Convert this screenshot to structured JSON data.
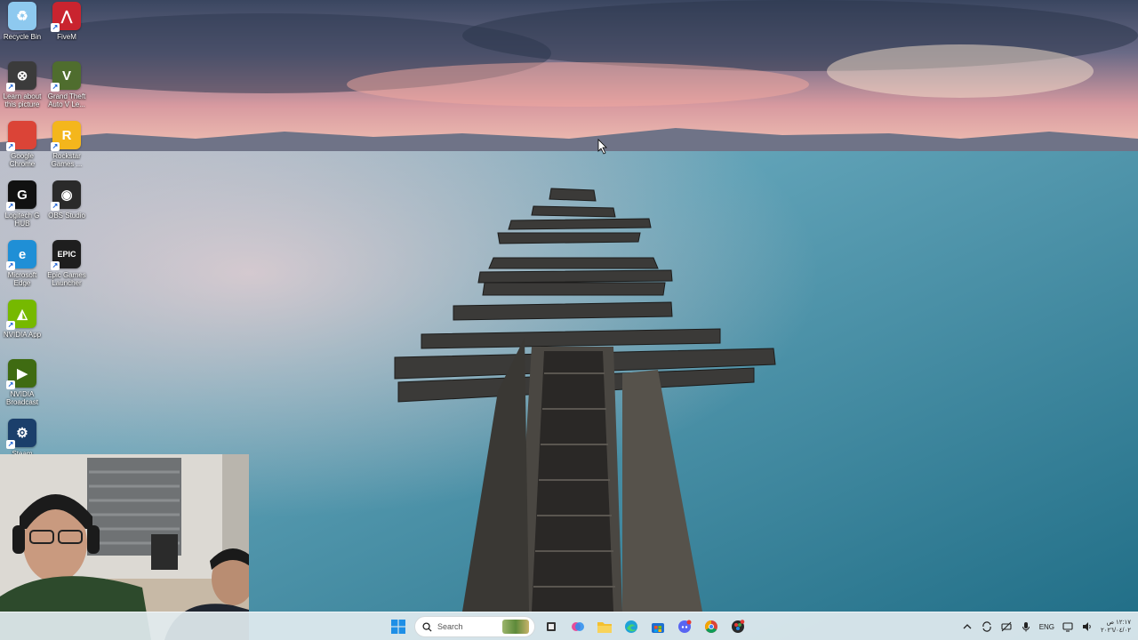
{
  "desktop": {
    "icons": [
      {
        "name": "recycle-bin",
        "label": "Recycle Bin",
        "glyph": "♻",
        "color": "#8ec9ef"
      },
      {
        "name": "fivem",
        "label": "FiveM",
        "glyph": "⋀",
        "color": "#c9242f"
      },
      {
        "name": "learn-about-picture",
        "label": "Learn about this picture",
        "glyph": "⊗",
        "color": "#3b3b3b"
      },
      {
        "name": "gta-v",
        "label": "Grand Theft Auto V Le...",
        "glyph": "V",
        "color": "#4f6d2e"
      },
      {
        "name": "google-chrome",
        "label": "Google Chrome",
        "glyph": "",
        "color": "#db4437"
      },
      {
        "name": "rockstar-games",
        "label": "Rockstar Games ...",
        "glyph": "R",
        "color": "#f4b61c"
      },
      {
        "name": "logitech-g-hub",
        "label": "Logitech G HUB",
        "glyph": "G",
        "color": "#111111"
      },
      {
        "name": "obs-studio",
        "label": "OBS Studio",
        "glyph": "◉",
        "color": "#2a2a2a"
      },
      {
        "name": "microsoft-edge",
        "label": "Microsoft Edge",
        "glyph": "e",
        "color": "#1f8fd6"
      },
      {
        "name": "epic-games",
        "label": "Epic Games Launcher",
        "glyph": "EPIC",
        "color": "#1e1e1e"
      },
      {
        "name": "nvidia-app",
        "label": "NVIDIA App",
        "glyph": "◭",
        "color": "#76b900"
      },
      {
        "name": "nvidia-broadcast",
        "label": "NVIDIA Broadcast",
        "glyph": "▶",
        "color": "#3f6b12"
      },
      {
        "name": "steam",
        "label": "Steam",
        "glyph": "⚙",
        "color": "#1b3f6b"
      }
    ]
  },
  "taskbar": {
    "search_placeholder": "Search",
    "apps": [
      {
        "name": "task-view-icon"
      },
      {
        "name": "copilot-icon"
      },
      {
        "name": "file-explorer-icon"
      },
      {
        "name": "edge-icon"
      },
      {
        "name": "microsoft-store-icon"
      },
      {
        "name": "discord-icon"
      },
      {
        "name": "chrome-icon"
      },
      {
        "name": "davinci-icon"
      }
    ],
    "tray": {
      "language": "ENG",
      "time": "١٢:١٧ ص",
      "date": "٢٠٢٦/٠٤/٠٢"
    }
  },
  "colors": {
    "sky_top": "#3e4a63",
    "sunset": "#f0a8a0",
    "water": "#3a8aa0",
    "taskbar": "#e2ecf0"
  }
}
